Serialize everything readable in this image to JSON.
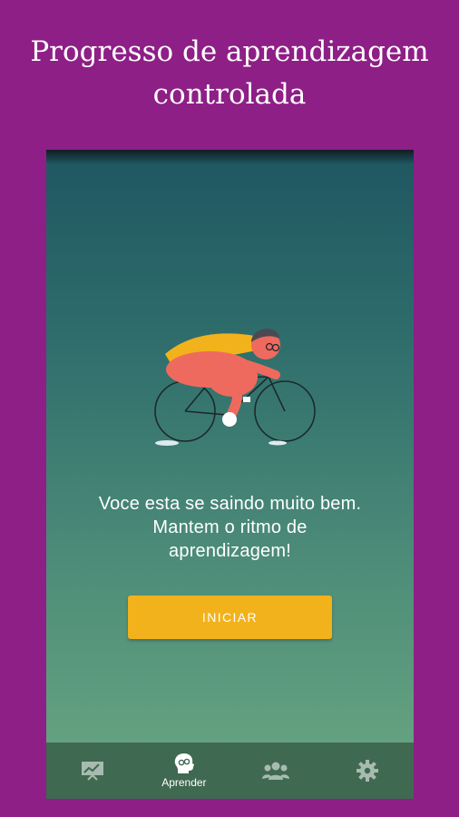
{
  "promo": {
    "title_line1": "Progresso de aprendizagem",
    "title_line2": "controlada"
  },
  "screen": {
    "message_line1": "Voce esta se saindo muito bem.",
    "message_line2": "Mantem o ritmo de",
    "message_line3": "aprendizagem!",
    "start_button_label": "INICIAR"
  },
  "nav": {
    "items": [
      {
        "icon": "chart-board-icon",
        "label": ""
      },
      {
        "icon": "brain-head-icon",
        "label": "Aprender"
      },
      {
        "icon": "group-icon",
        "label": ""
      },
      {
        "icon": "gear-icon",
        "label": ""
      }
    ]
  },
  "colors": {
    "page_background": "#8e1f86",
    "button": "#f2b21b",
    "cape": "#f2b21b",
    "rider": "#ef6a5e",
    "nav_background": "#3f6950"
  }
}
